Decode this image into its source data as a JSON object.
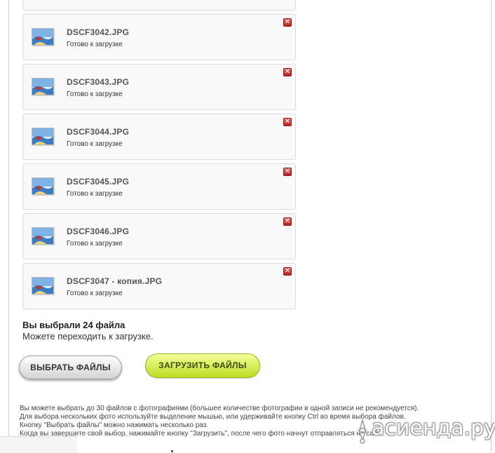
{
  "files": [
    {
      "name": "DSCF3042.JPG",
      "status": "Готово к загрузке"
    },
    {
      "name": "DSCF3043.JPG",
      "status": "Готово к загрузке"
    },
    {
      "name": "DSCF3044.JPG",
      "status": "Готово к загрузке"
    },
    {
      "name": "DSCF3045.JPG",
      "status": "Готово к загрузке"
    },
    {
      "name": "DSCF3046.JPG",
      "status": "Готово к загрузке"
    },
    {
      "name": "DSCF3047 - копия.JPG",
      "status": "Готово к загрузке"
    }
  ],
  "icons": {
    "file": "image-file-icon",
    "remove": "close-icon"
  },
  "remove_glyph": "✕",
  "summary": {
    "title": "Вы выбрали 24 файла",
    "subtitle": "Можете переходить к загрузке."
  },
  "buttons": {
    "select_label": "ВЫБРАТЬ ФАЙЛЫ",
    "upload_label": "ЗАГРУЗИТЬ ФАЙЛЫ"
  },
  "hints": [
    "Вы можете выбрать до 30 файлов с фотографиями (большее количестве фотографии в одной записи не рекомендуется).",
    "Для выбора нескольких фото используйте выделение мышью, или удерживайте кнопку Ctrl во время выбора файлов.",
    "Кнопку \"Выбрать файлы\" можно нажимать несколько раз.",
    "Когда вы завершите свой выбор, нажимайте кнопку \"Загрузить\", после чего фото начнут отправляться на сайт."
  ],
  "watermark": {
    "text": "асиенда.ру"
  },
  "colors": {
    "upload_button": "#cbe83a",
    "remove_button": "#c0392b",
    "item_border": "#dcdcdc"
  }
}
